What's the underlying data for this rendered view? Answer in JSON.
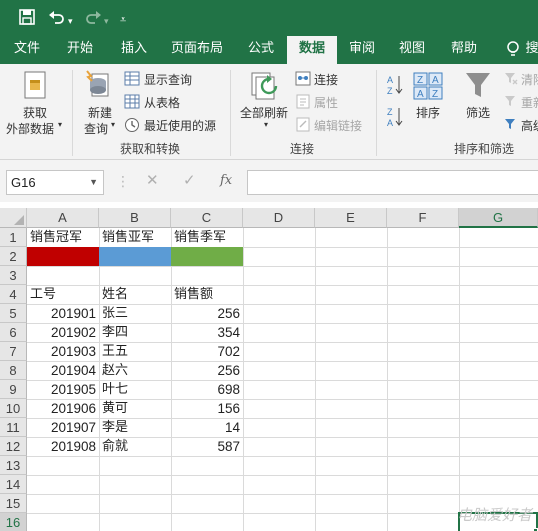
{
  "quick_access": {
    "save_icon": "save-icon",
    "undo_icon": "undo-icon",
    "redo_icon": "redo-icon",
    "customize_icon": "customize-icon"
  },
  "tabs": [
    "文件",
    "开始",
    "插入",
    "页面布局",
    "公式",
    "数据",
    "审阅",
    "视图",
    "帮助"
  ],
  "active_tab": "数据",
  "ribbon": {
    "get_data_line1": "获取",
    "get_data_line2": "外部数据",
    "new_query_line1": "新建",
    "new_query_line2": "查询",
    "show_queries": "显示查询",
    "from_table": "从表格",
    "recent_sources": "最近使用的源",
    "group_get_transform": "获取和转换",
    "refresh_all": "全部刷新",
    "connections": "连接",
    "properties": "属性",
    "edit_links": "编辑链接",
    "group_connections": "连接",
    "sort": "排序",
    "filter": "筛选",
    "clear": "清除",
    "reapply": "重新",
    "advanced": "高级",
    "group_sort_filter": "排序和筛选"
  },
  "formula_bar": {
    "name_box": "G16",
    "fx_label": "fx",
    "formula": ""
  },
  "columns": [
    "A",
    "B",
    "C",
    "D",
    "E",
    "F",
    "G"
  ],
  "rows": [
    "1",
    "2",
    "3",
    "4",
    "5",
    "6",
    "7",
    "8",
    "9",
    "10",
    "11",
    "12",
    "13",
    "14",
    "15",
    "16"
  ],
  "selected_cell": "G16",
  "cells": {
    "row1": [
      "销售冠军",
      "销售亚军",
      "销售季军"
    ],
    "row2_colors": [
      "#c00000",
      "#5b9bd5",
      "#70ad47"
    ],
    "headers": [
      "工号",
      "姓名",
      "销售额"
    ],
    "records": [
      {
        "id": "201901",
        "name": "张三",
        "sales": "256"
      },
      {
        "id": "201902",
        "name": "李四",
        "sales": "354"
      },
      {
        "id": "201903",
        "name": "王五",
        "sales": "702"
      },
      {
        "id": "201904",
        "name": "赵六",
        "sales": "256"
      },
      {
        "id": "201905",
        "name": "叶七",
        "sales": "698"
      },
      {
        "id": "201906",
        "name": "黄可",
        "sales": "156"
      },
      {
        "id": "201907",
        "name": "李是",
        "sales": "14"
      },
      {
        "id": "201908",
        "name": "俞就",
        "sales": "587"
      }
    ]
  },
  "watermark": "电脑爱好者",
  "colors": {
    "accent": "#217346"
  }
}
